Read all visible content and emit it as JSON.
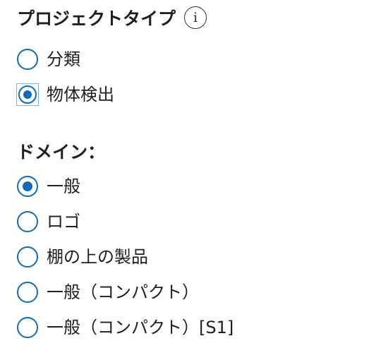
{
  "project_type": {
    "title": "プロジェクトタイプ",
    "info_symbol": "i",
    "options": [
      {
        "label": "分類",
        "checked": false
      },
      {
        "label": "物体検出",
        "checked": true
      }
    ]
  },
  "domain": {
    "title": "ドメイン：",
    "options": [
      {
        "label": "一般",
        "checked": true
      },
      {
        "label": "ロゴ",
        "checked": false
      },
      {
        "label": "棚の上の製品",
        "checked": false
      },
      {
        "label": "一般（コンパクト）",
        "checked": false
      },
      {
        "label": "一般（コンパクト）[S1]",
        "checked": false
      }
    ]
  },
  "colors": {
    "accent": "#0f6cbd",
    "text": "#201f1e",
    "focus_outline": "#7fb3e0"
  }
}
